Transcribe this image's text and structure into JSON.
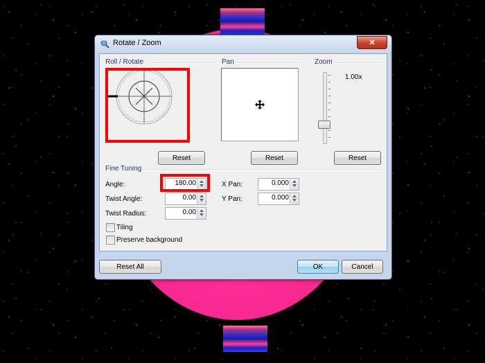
{
  "dialog": {
    "title": "Rotate / Zoom",
    "close_label": "✕"
  },
  "sections": {
    "roll_rotate": "Roll / Rotate",
    "pan": "Pan",
    "zoom": "Zoom",
    "fine_tuning": "Fine Tuning"
  },
  "zoom": {
    "value_text": "1.00x"
  },
  "buttons": {
    "reset_label": "Reset",
    "reset_all_label": "Reset All",
    "ok_label": "OK",
    "cancel_label": "Cancel"
  },
  "fields": {
    "angle": {
      "label": "Angle:",
      "value": "180.00"
    },
    "twist_angle": {
      "label": "Twist Angle:",
      "value": "0.00"
    },
    "twist_radius": {
      "label": "Twist Radius:",
      "value": "0.00"
    },
    "x_pan": {
      "label": "X Pan:",
      "value": "0.000"
    },
    "y_pan": {
      "label": "Y Pan:",
      "value": "0.000"
    }
  },
  "checkboxes": {
    "tiling": {
      "label": "Tiling",
      "checked": false
    },
    "preserve_background": {
      "label": "Preserve background",
      "checked": false
    }
  },
  "colors": {
    "highlight": "#ff0000",
    "section_label": "#1e3287",
    "background_planet": "#ff2d96"
  },
  "icons": {
    "pan": "move-cross-icon",
    "title": "rotate-zoom-icon"
  }
}
